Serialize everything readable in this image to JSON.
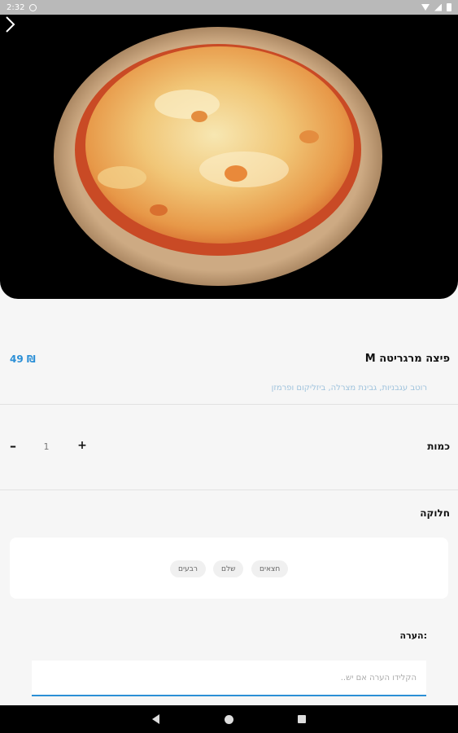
{
  "status_bar": {
    "time": "2:32",
    "icons": [
      "notification-icon",
      "wifi-icon",
      "signal-icon",
      "battery-icon"
    ]
  },
  "hero": {
    "image": "pizza-margherita-photo",
    "next_icon": "chevron-right-icon"
  },
  "product": {
    "title": "פיצה מרגריטה M",
    "price": "49 ₪",
    "description": "רוטב עגבניות, גבינת מצרלה, ביזליקום ופרמזן"
  },
  "quantity": {
    "label": "כמות",
    "value": "1",
    "minus": "–",
    "plus": "+"
  },
  "division": {
    "label": "חלוקה",
    "options": [
      "חצאים",
      "שלם",
      "רבעים"
    ]
  },
  "note": {
    "label": "הערה:",
    "placeholder": "הקלידו הערה אם יש.."
  },
  "colors": {
    "accent": "#2b8fd6",
    "description": "#9fc3dd",
    "background": "#f6f6f6"
  }
}
